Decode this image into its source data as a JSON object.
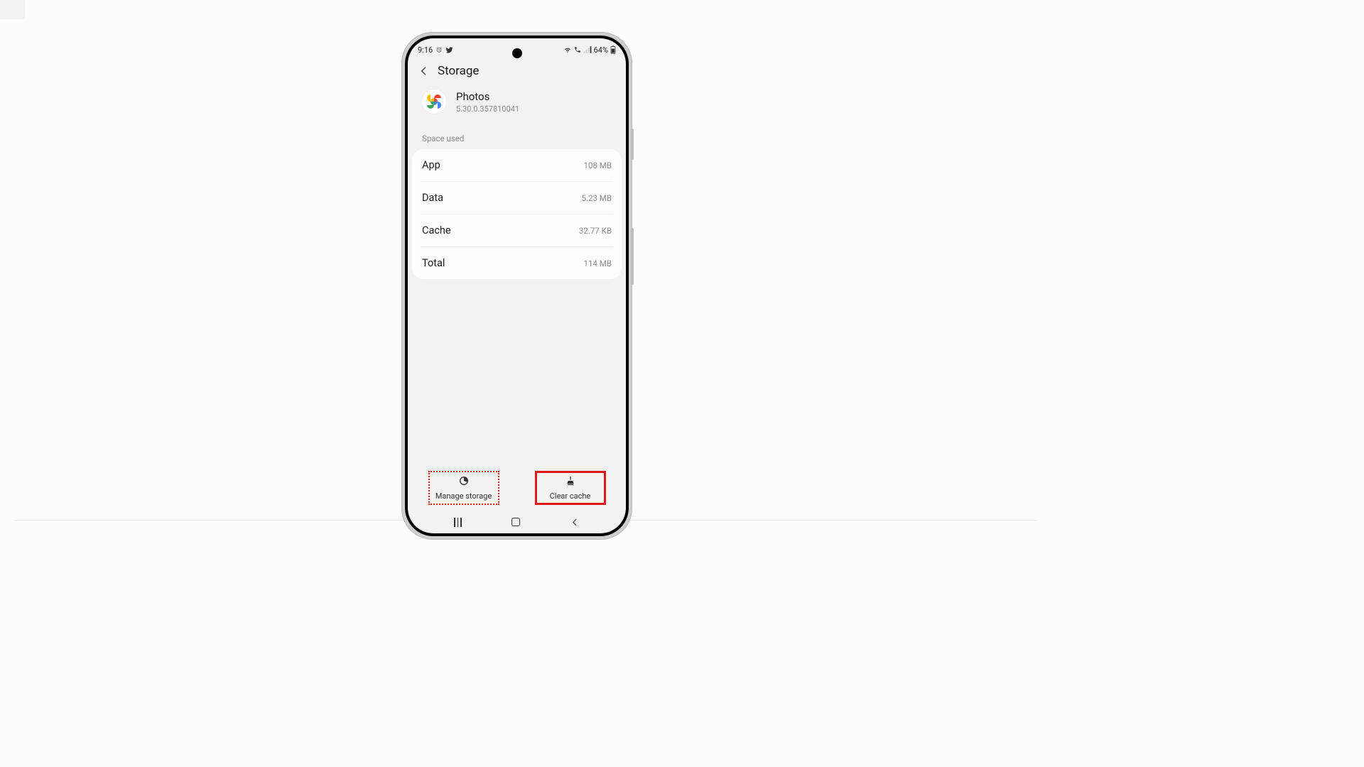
{
  "status_bar": {
    "time": "9:16",
    "battery_percent": "64%"
  },
  "header": {
    "title": "Storage"
  },
  "app_info": {
    "name": "Photos",
    "version": "5.30.0.357810041"
  },
  "section": {
    "space_used_label": "Space used"
  },
  "storage": {
    "rows": [
      {
        "label": "App",
        "value": "108 MB"
      },
      {
        "label": "Data",
        "value": "5.23 MB"
      },
      {
        "label": "Cache",
        "value": "32.77 KB"
      },
      {
        "label": "Total",
        "value": "114 MB"
      }
    ]
  },
  "actions": {
    "manage_storage_label": "Manage storage",
    "clear_cache_label": "Clear cache"
  }
}
